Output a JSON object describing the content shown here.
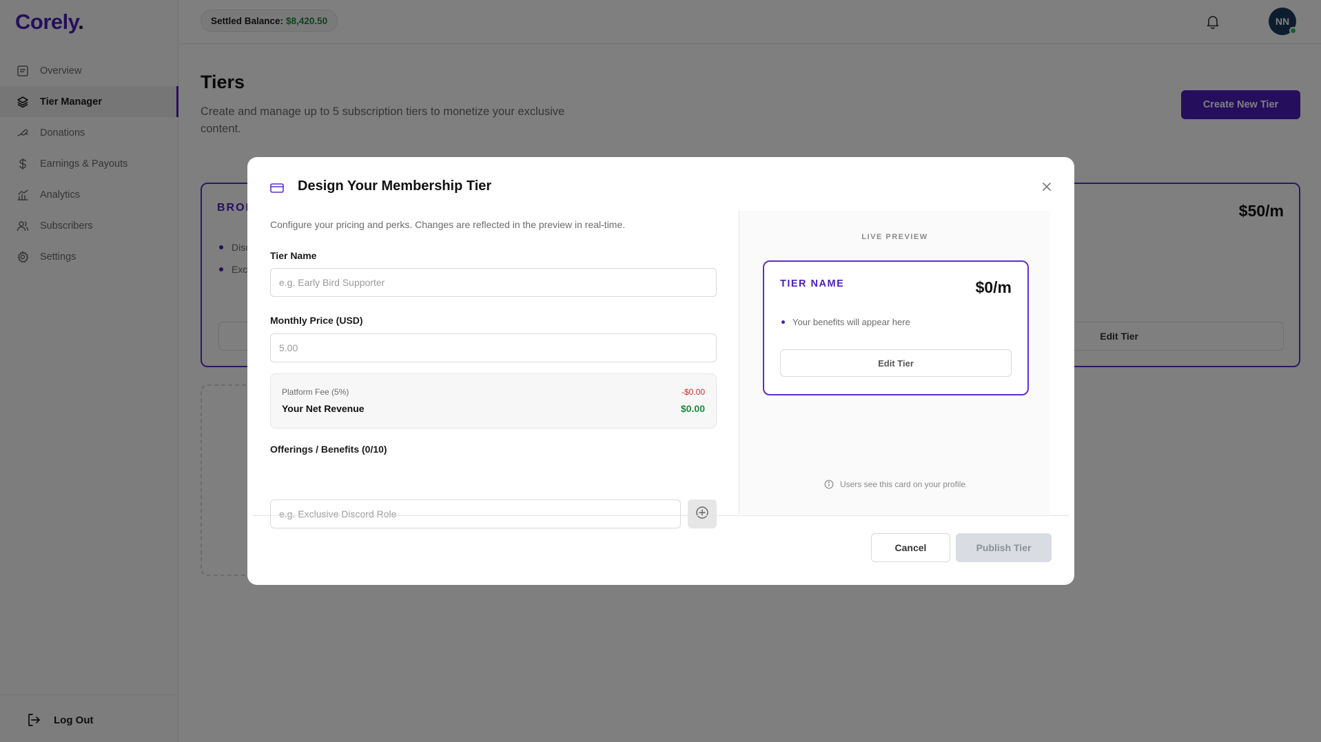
{
  "app": {
    "logo": "Corely",
    "logo_dot": "."
  },
  "sidebar": {
    "items": [
      {
        "label": "Overview",
        "icon": "overview-icon",
        "active": false
      },
      {
        "label": "Tier Manager",
        "icon": "layers-icon",
        "active": true
      },
      {
        "label": "Donations",
        "icon": "donation-icon",
        "active": false
      },
      {
        "label": "Earnings & Payouts",
        "icon": "dollar-icon",
        "active": false
      },
      {
        "label": "Analytics",
        "icon": "chart-icon",
        "active": false
      },
      {
        "label": "Subscribers",
        "icon": "users-icon",
        "active": false
      },
      {
        "label": "Settings",
        "icon": "gear-icon",
        "active": false
      }
    ],
    "logout_label": "Log Out"
  },
  "header": {
    "balance_label": "Settled Balance:",
    "balance_amount": "$8,420.50",
    "avatar_initials": "NN"
  },
  "main": {
    "title": "Tiers",
    "description": "Create and manage up to 5 subscription tiers to monetize your exclusive content.",
    "create_button": "Create New Tier",
    "tier_card": {
      "name": "BRON",
      "price": "$50/m",
      "perks": [
        "Disc",
        "Excl"
      ],
      "edit_label": "Edit Tier"
    }
  },
  "modal": {
    "title": "Design Your Membership Tier",
    "subtitle": "Configure your pricing and perks. Changes are reflected in the preview in real-time.",
    "tier_name_label": "Tier Name",
    "tier_name_placeholder": "e.g. Early Bird Supporter",
    "price_label": "Monthly Price (USD)",
    "price_placeholder": "5.00",
    "fee_label": "Platform Fee (5%)",
    "fee_value": "-$0.00",
    "net_label": "Your Net Revenue",
    "net_value": "$0.00",
    "offerings_label": "Offerings / Benefits (0/10)",
    "offering_placeholder": "e.g. Exclusive Discord Role",
    "preview": {
      "label": "LIVE PREVIEW",
      "tier_name": "TIER NAME",
      "price": "$0/m",
      "perk": "Your benefits will appear here",
      "edit_label": "Edit Tier",
      "note": "Users see this card on your profile"
    },
    "cancel_label": "Cancel",
    "publish_label": "Publish Tier"
  },
  "colors": {
    "brand": "#4a1fb8",
    "positive": "#1e8a3c",
    "negative": "#d12c2c",
    "avatar_bg": "#1b3a5c"
  }
}
